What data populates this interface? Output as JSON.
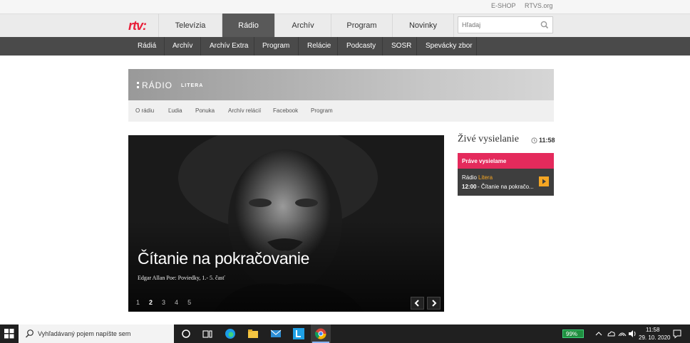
{
  "topbar": {
    "eshop": "E-SHOP",
    "rtvs": "RTVS.org"
  },
  "logo": "rtv:",
  "mainnav": [
    {
      "label": "Televízia",
      "active": false
    },
    {
      "label": "Rádio",
      "active": true
    },
    {
      "label": "Archív",
      "active": false
    },
    {
      "label": "Program",
      "active": false
    },
    {
      "label": "Novinky",
      "active": false
    }
  ],
  "search": {
    "placeholder": "Hľadaj"
  },
  "subnav": [
    "Rádiá",
    "Archív",
    "Archív Extra",
    "Program",
    "Relácie",
    "Podcasty",
    "SOSR",
    "Spevácky zbor"
  ],
  "banner": {
    "brand": "RÁDIO",
    "station": "LITERA"
  },
  "stationnav": [
    "O rádiu",
    "Ľudia",
    "Ponuka",
    "Archív relácií",
    "Facebook",
    "Program"
  ],
  "hero": {
    "title": "Čítanie na pokračovanie",
    "subtitle": "Edgar Allan Poe: Poviedky, 1.- 5. časť",
    "pages": [
      "1",
      "2",
      "3",
      "4",
      "5"
    ],
    "active_page": "2"
  },
  "live": {
    "heading": "Živé vysielanie",
    "time": "11:58",
    "now_label": "Práve vysielame",
    "station_prefix": "Rádio",
    "station_name": "Litera",
    "show_time": "12:00",
    "show_title": "- Čítanie na pokračo..."
  },
  "taskbar": {
    "search_placeholder": "Vyhľadávaný pojem napíšte sem",
    "battery": "99%",
    "clock_time": "11:58",
    "clock_date": "29. 10. 2020"
  },
  "colors": {
    "accent_red": "#e8203a",
    "live_pink": "#e42a5c",
    "nav_dark": "#4a4a4a"
  }
}
